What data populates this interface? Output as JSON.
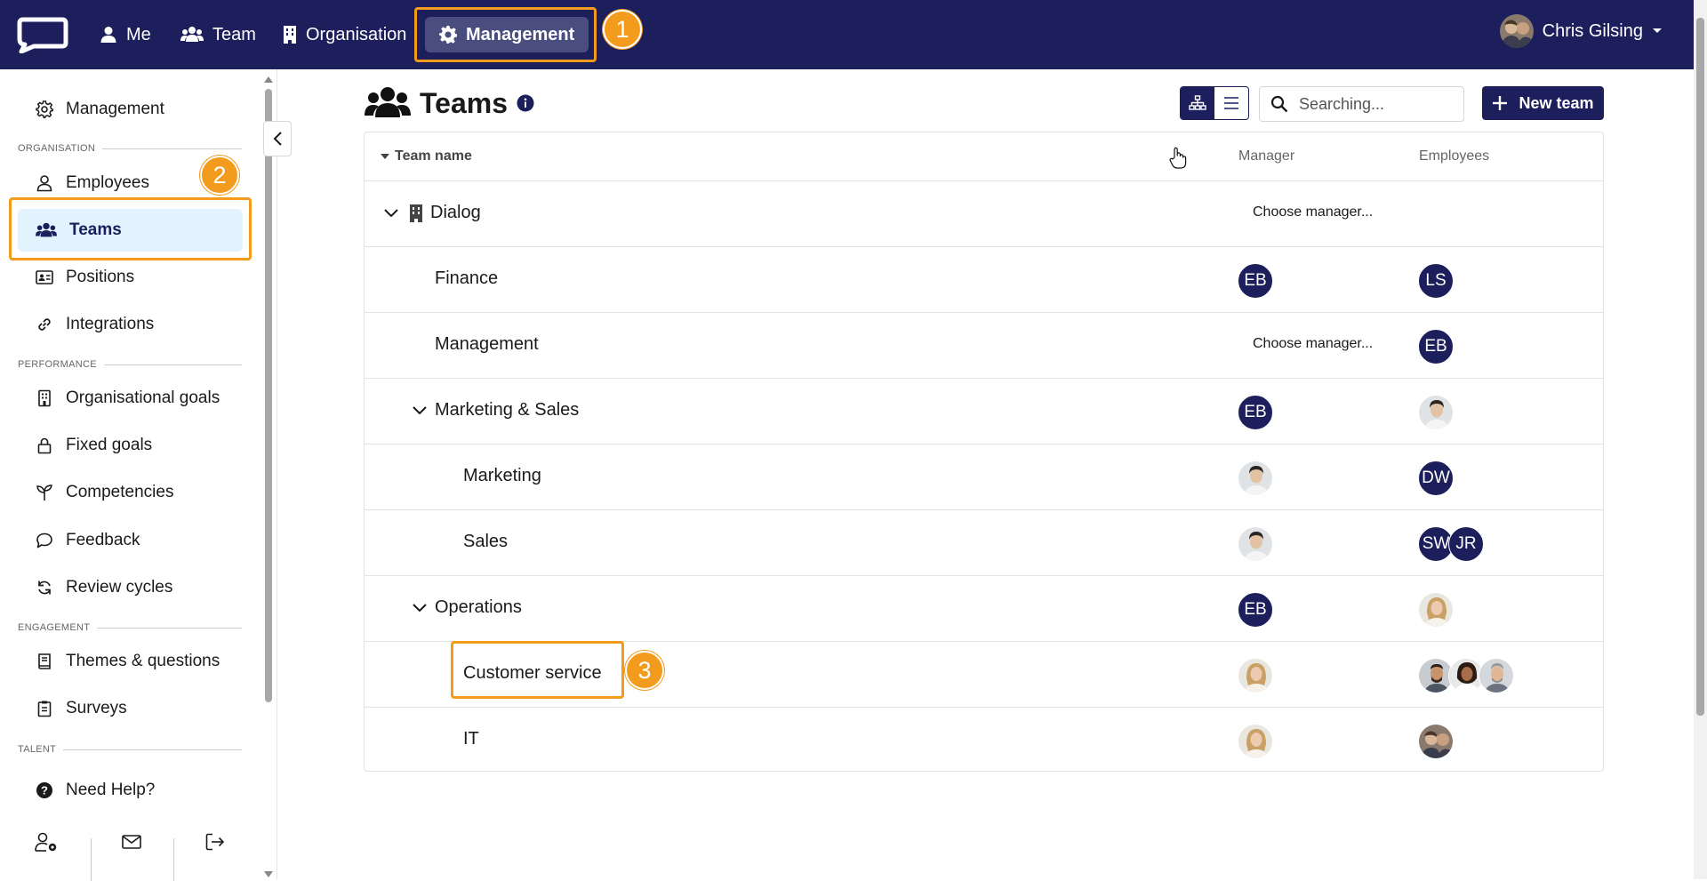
{
  "topnav": {
    "items": [
      {
        "label": "Me",
        "icon": "user-icon"
      },
      {
        "label": "Team",
        "icon": "users-icon"
      },
      {
        "label": "Organisation",
        "icon": "building-icon"
      },
      {
        "label": "Management",
        "icon": "gear-icon"
      }
    ],
    "user_name": "Chris Gilsing"
  },
  "annotations": [
    "1",
    "2",
    "3"
  ],
  "sidebar": {
    "top_item": "Management",
    "sections": {
      "organisation": "ORGANISATION",
      "performance": "PERFORMANCE",
      "engagement": "ENGAGEMENT",
      "talent": "TALENT"
    },
    "items": {
      "employees": "Employees",
      "teams": "Teams",
      "positions": "Positions",
      "integrations": "Integrations",
      "organisational_goals": "Organisational goals",
      "fixed_goals": "Fixed goals",
      "competencies": "Competencies",
      "feedback": "Feedback",
      "review_cycles": "Review cycles",
      "themes_questions": "Themes & questions",
      "surveys": "Surveys",
      "need_help": "Need Help?"
    }
  },
  "main": {
    "title": "Teams",
    "search_placeholder": "Searching...",
    "new_team_label": "New team",
    "columns": {
      "team_name": "Team name",
      "manager": "Manager",
      "employees": "Employees"
    },
    "choose_manager": "Choose manager...",
    "rows": [
      {
        "name": "Dialog",
        "manager": "choose",
        "employees": []
      },
      {
        "name": "Finance",
        "manager": "EB",
        "employees": [
          "LS"
        ]
      },
      {
        "name": "Management",
        "manager": "choose",
        "employees": [
          "EB"
        ]
      },
      {
        "name": "Marketing & Sales",
        "manager": "EB",
        "employees": [
          "photo"
        ]
      },
      {
        "name": "Marketing",
        "manager": "photo",
        "employees": [
          "DW"
        ]
      },
      {
        "name": "Sales",
        "manager": "photo",
        "employees": [
          "SW",
          "JR"
        ]
      },
      {
        "name": "Operations",
        "manager": "EB",
        "employees": [
          "photo"
        ]
      },
      {
        "name": "Customer service",
        "manager": "photo",
        "employees": [
          "photo",
          "photo",
          "photo"
        ]
      },
      {
        "name": "IT",
        "manager": "photo",
        "employees": [
          "photo"
        ]
      }
    ]
  },
  "colors": {
    "brand": "#1c1f5c",
    "highlight": "#f29b1d",
    "active_bg": "#e2f3fd"
  }
}
